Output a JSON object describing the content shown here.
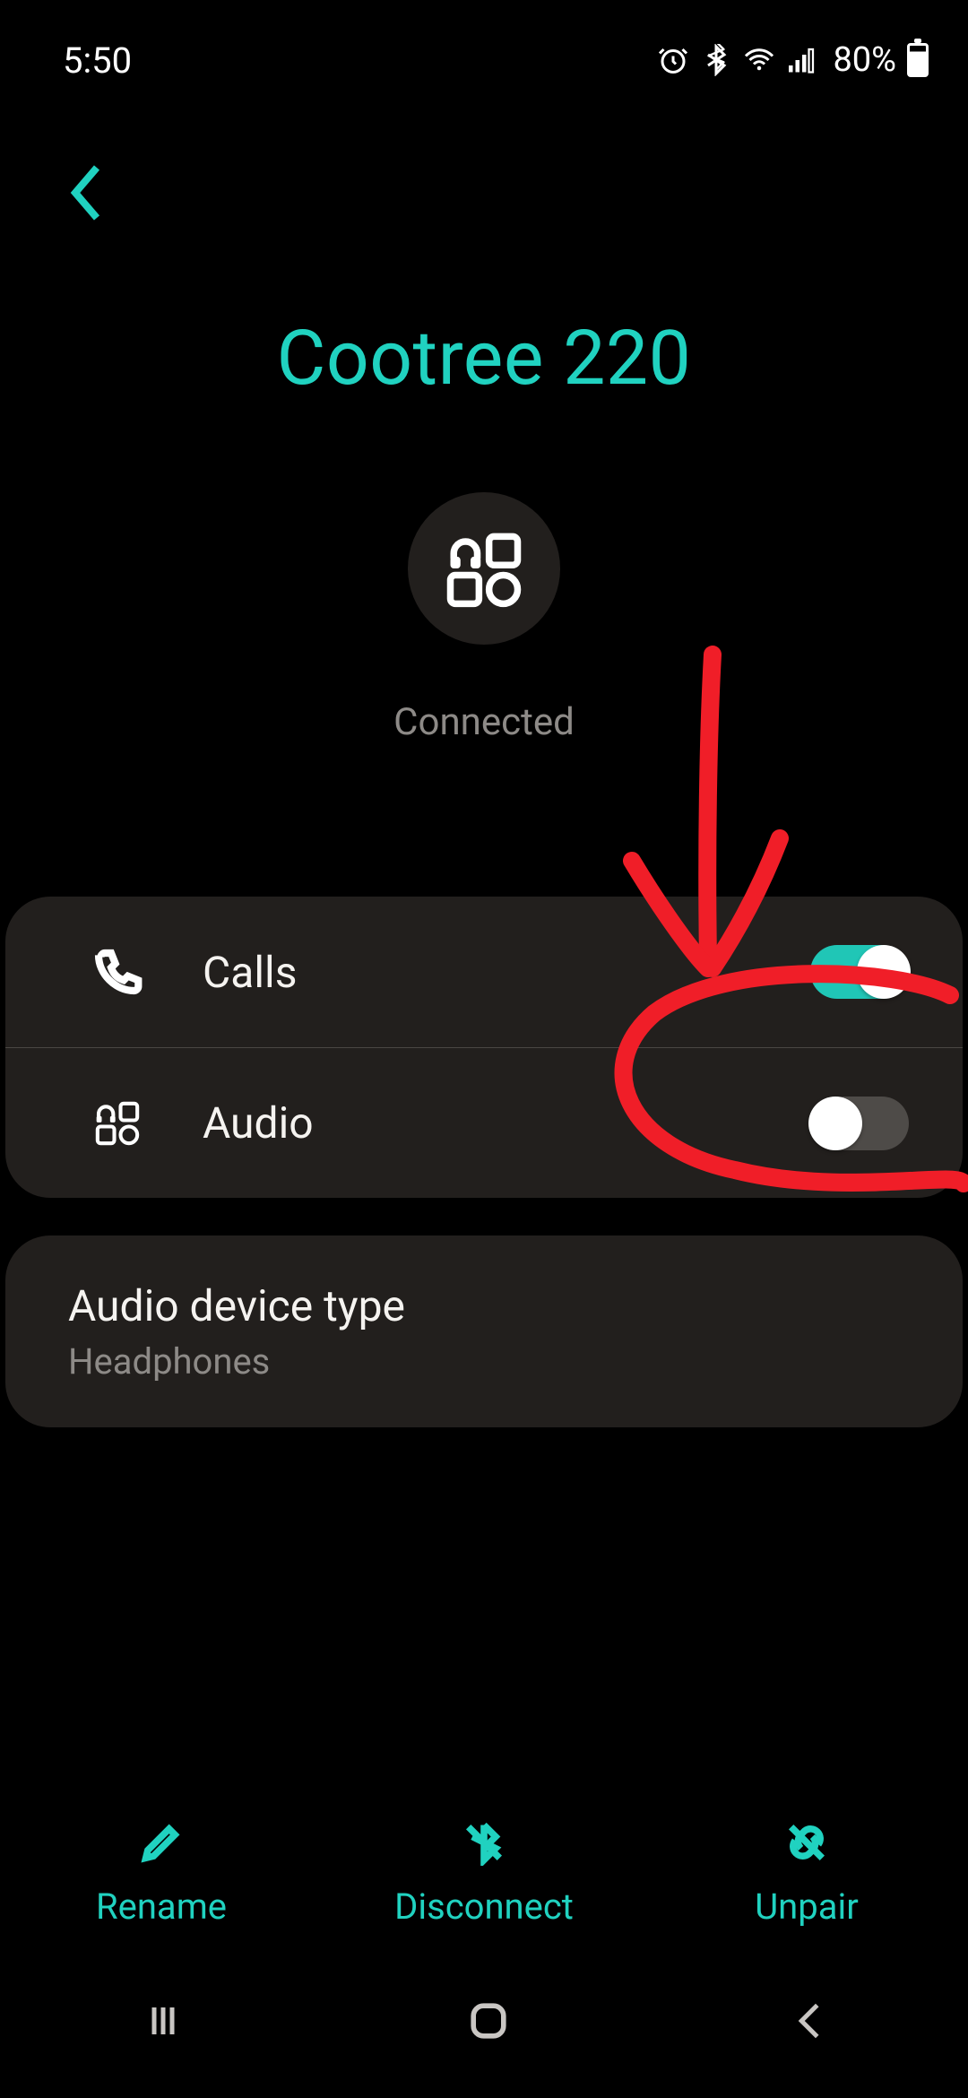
{
  "status_bar": {
    "time": "5:50",
    "battery_percent": "80%"
  },
  "header": {
    "title": "Cootree 220",
    "connection_status": "Connected"
  },
  "profiles": [
    {
      "icon": "phone-icon",
      "label": "Calls",
      "enabled": true
    },
    {
      "icon": "media-icon",
      "label": "Audio",
      "enabled": false
    }
  ],
  "audio_device": {
    "label": "Audio device type",
    "value": "Headphones"
  },
  "actions": {
    "rename": "Rename",
    "disconnect": "Disconnect",
    "unpair": "Unpair"
  },
  "colors": {
    "accent": "#20d2c0",
    "card": "#221f1d",
    "bg": "#000000",
    "annotation": "#f01e28"
  }
}
